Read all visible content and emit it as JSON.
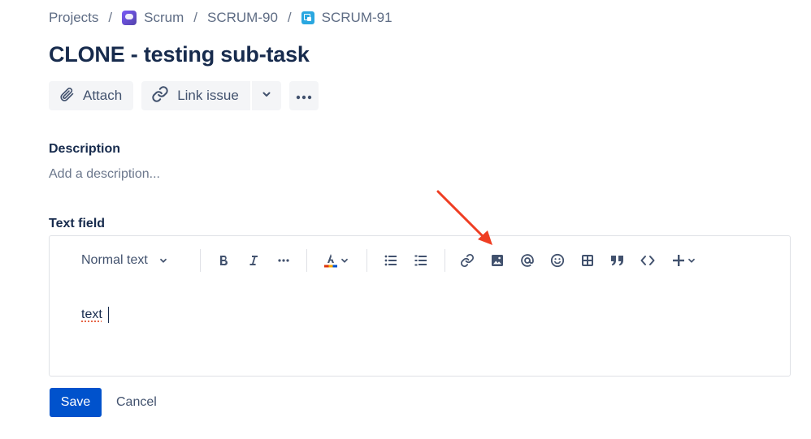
{
  "breadcrumb": {
    "projects": "Projects",
    "project": "Scrum",
    "parent": "SCRUM-90",
    "issue": "SCRUM-91",
    "separator": "/"
  },
  "issue": {
    "title": "CLONE - testing sub-task"
  },
  "actions": {
    "attach_label": "Attach",
    "link_issue_label": "Link issue",
    "link_dropdown_icon": "chevron-down-icon",
    "more_icon": "more-icon"
  },
  "description": {
    "label": "Description",
    "placeholder": "Add a description..."
  },
  "text_field": {
    "label": "Text field",
    "toolbar": {
      "text_style": "Normal text",
      "tools": [
        "bold-icon",
        "italic-icon",
        "more-formatting-icon",
        "text-color-icon",
        "bullet-list-icon",
        "numbered-list-icon",
        "link-icon",
        "image-icon",
        "mention-icon",
        "emoji-icon",
        "table-icon",
        "quote-icon",
        "code-icon",
        "insert-icon"
      ]
    },
    "content": "text"
  },
  "footer": {
    "save_label": "Save",
    "cancel_label": "Cancel"
  },
  "colors": {
    "primary": "#0052cc",
    "text": "#172b4d",
    "subtle": "#6b778c",
    "annotation": "#ef3e23"
  }
}
